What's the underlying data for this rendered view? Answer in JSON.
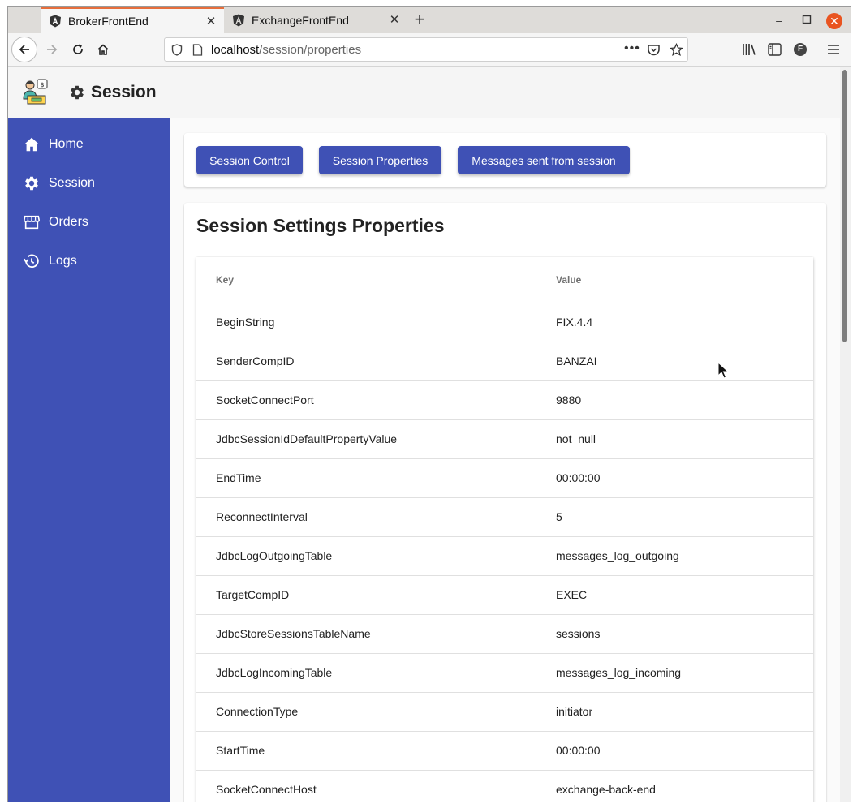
{
  "browser": {
    "tabs": [
      {
        "title": "BrokerFrontEnd",
        "active": true
      },
      {
        "title": "ExchangeFrontEnd",
        "active": false
      }
    ],
    "url_host": "localhost",
    "url_path": "/session/properties",
    "accent_color": "#e66e3c"
  },
  "app": {
    "header_title": "Session",
    "primary_color": "#3f51b5"
  },
  "sidebar": {
    "items": [
      {
        "label": "Home",
        "icon": "home-icon"
      },
      {
        "label": "Session",
        "icon": "gear-icon"
      },
      {
        "label": "Orders",
        "icon": "store-icon"
      },
      {
        "label": "Logs",
        "icon": "history-icon"
      }
    ]
  },
  "actions": {
    "buttons": [
      {
        "label": "Session Control"
      },
      {
        "label": "Session Properties"
      },
      {
        "label": "Messages sent from session"
      }
    ]
  },
  "properties": {
    "title": "Session Settings Properties",
    "columns": {
      "key": "Key",
      "value": "Value"
    },
    "rows": [
      {
        "key": "BeginString",
        "value": "FIX.4.4"
      },
      {
        "key": "SenderCompID",
        "value": "BANZAI"
      },
      {
        "key": "SocketConnectPort",
        "value": "9880"
      },
      {
        "key": "JdbcSessionIdDefaultPropertyValue",
        "value": "not_null"
      },
      {
        "key": "EndTime",
        "value": "00:00:00"
      },
      {
        "key": "ReconnectInterval",
        "value": "5"
      },
      {
        "key": "JdbcLogOutgoingTable",
        "value": "messages_log_outgoing"
      },
      {
        "key": "TargetCompID",
        "value": "EXEC"
      },
      {
        "key": "JdbcStoreSessionsTableName",
        "value": "sessions"
      },
      {
        "key": "JdbcLogIncomingTable",
        "value": "messages_log_incoming"
      },
      {
        "key": "ConnectionType",
        "value": "initiator"
      },
      {
        "key": "StartTime",
        "value": "00:00:00"
      },
      {
        "key": "SocketConnectHost",
        "value": "exchange-back-end"
      }
    ]
  }
}
